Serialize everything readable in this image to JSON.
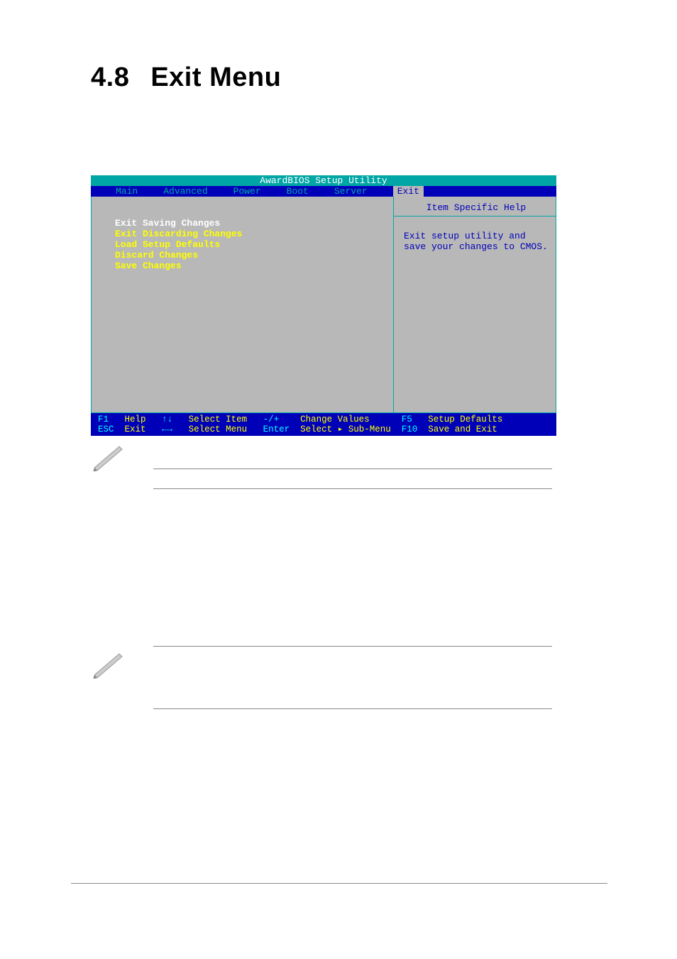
{
  "page": {
    "section_number": "4.8",
    "section_title": "Exit Menu"
  },
  "bios": {
    "title": "AwardBIOS Setup Utility",
    "tabs": [
      "Main",
      "Advanced",
      "Power",
      "Boot",
      "Server",
      "Exit"
    ],
    "active_tab_index": 5,
    "left_items": [
      "Exit Saving Changes",
      "Exit Discarding Changes",
      "Load Setup Defaults",
      "Discard Changes",
      "Save Changes"
    ],
    "selected_item_index": 0,
    "help_title": "Item Specific Help",
    "help_text": "Exit setup utility and save your changes to CMOS.",
    "footer": {
      "f1": "F1",
      "help": "Help",
      "updn_sym": "↑↓",
      "select_item": "Select Item",
      "pm": "-/+",
      "change_values": "Change Values",
      "f5": "F5",
      "setup_defaults": "Setup Defaults",
      "esc": "ESC",
      "exit": "Exit",
      "lr_sym": "←→",
      "select_menu": "Select Menu",
      "enter": "Enter",
      "select_sub": "Select ▸ Sub-Menu",
      "f10": "F10",
      "save_exit": "Save and Exit"
    }
  }
}
